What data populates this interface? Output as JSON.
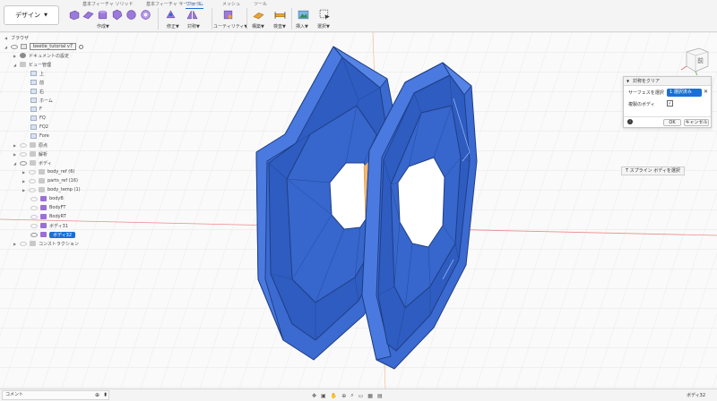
{
  "toolbar": {
    "design_button": "デザイン",
    "tabs": [
      {
        "label": "基本フィーチャ ソリッド"
      },
      {
        "label": "基本フィーチャ サーフェス"
      },
      {
        "label": "フォーム",
        "active": true
      },
      {
        "label": "メッシュ"
      },
      {
        "label": "ツール"
      }
    ],
    "groups": [
      "作成▼",
      "修正▼",
      "対称▼",
      "ユーティリティ▼",
      "構築▼",
      "検査▼",
      "挿入▼",
      "選択▼"
    ]
  },
  "browser": {
    "title": "ブラウザ",
    "document_name": "beetle_tutorial v7",
    "doc_settings": "ドキュメントの設定",
    "named_views": "ビュー管理",
    "views": [
      "上",
      "前",
      "右",
      "ホーム",
      "F",
      "FQ",
      "FQ2",
      "Fore"
    ],
    "origin": "原点",
    "analysis": "解析",
    "bodies_folder": "ボディ",
    "body_groups": [
      "body_ref (6)",
      "parts_ref (16)",
      "body_temp (1)"
    ],
    "bodies": [
      "bodyB",
      "BodyFT",
      "BodyRT",
      "ボディ31"
    ],
    "selected_body": "ボディ32",
    "construction": "コンストラクション"
  },
  "dialog": {
    "title": "対称をクリア",
    "surface_label": "サーフェスを選択",
    "selection_chip": "1 選択済み",
    "copy_body_label": "複製のボディ",
    "ok": "OK",
    "cancel": "キャンセル"
  },
  "viewcube": {
    "face": "前"
  },
  "tooltip": "T スプライン ボディを選択",
  "bottom": {
    "comments": "コメント",
    "status": "ボディ32"
  },
  "colors": {
    "accent": "#1a6fd6",
    "model_blue": "#3a69c9",
    "toolbar_bg": "#f4f4f4",
    "grid": "#d9d9d9",
    "axis_red": "#e86060"
  }
}
